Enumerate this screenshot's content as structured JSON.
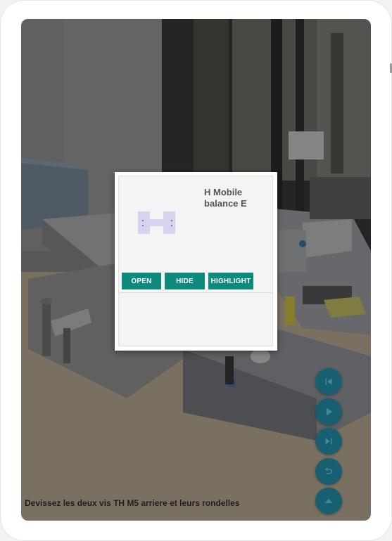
{
  "instruction": "Devissez les deux vis TH M5 arriere et leurs rondelles",
  "dialog": {
    "title": "H Mobile balance E",
    "buttons": {
      "open": "OPEN",
      "hide": "HIDE",
      "highlight": "HIGHLIGHT"
    }
  },
  "controls": {
    "icons": [
      "skip-previous-icon",
      "play-icon",
      "skip-next-icon",
      "undo-icon",
      "chevron-up-icon"
    ]
  },
  "colors": {
    "button": "#0d8a7c",
    "fab": "#175f71",
    "part": "#d4d4ee"
  }
}
